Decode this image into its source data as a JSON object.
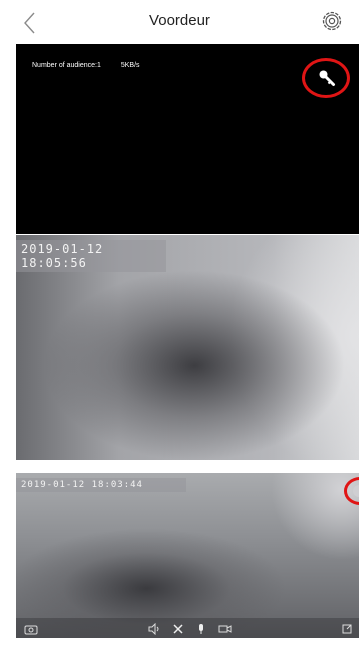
{
  "header": {
    "title": "Voordeur",
    "back_icon": "chevron-left-icon",
    "settings_icon": "gear-icon"
  },
  "live_view": {
    "audience_label": "Number of audience:1",
    "bitrate": "5KB/s",
    "key_icon": "key-icon"
  },
  "frames": [
    {
      "timestamp": "2019-01-12  18:05:56"
    },
    {
      "timestamp": "2019-01-12  18:03:44"
    }
  ],
  "toolbar": {
    "icons": [
      "camera-icon",
      "speaker-icon",
      "hang-up-icon",
      "microphone-icon",
      "record-video-icon",
      "fullscreen-icon"
    ]
  },
  "colors": {
    "highlight_circle": "#e01515",
    "live_background": "#000000"
  }
}
